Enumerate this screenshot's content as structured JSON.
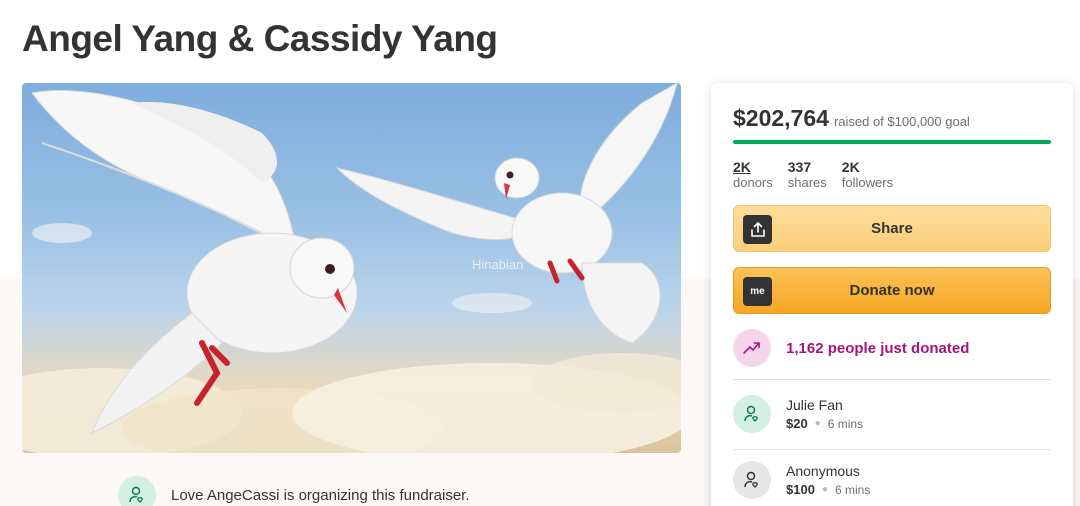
{
  "page": {
    "title": "Angel Yang & Cassidy Yang"
  },
  "hero": {
    "watermark": "Hinabian",
    "image_description_icon": "doves-photo"
  },
  "organizer": {
    "text": "Love AngeCassi is organizing this fundraiser.",
    "icon": "person-heart-icon"
  },
  "donation_card": {
    "amount_raised": "$202,764",
    "goal_text": "raised of $100,000 goal",
    "progress": 1.0,
    "stats": [
      {
        "value": "2K",
        "label": "donors"
      },
      {
        "value": "337",
        "label": "shares"
      },
      {
        "value": "2K",
        "label": "followers"
      }
    ],
    "share_label": "Share",
    "donate_label": "Donate now",
    "donate_icon_text": "me",
    "recent_text": "1,162 people just donated",
    "donors": [
      {
        "name": "Julie Fan",
        "amount": "$20",
        "time": "6 mins",
        "icon": "person-heart-icon"
      },
      {
        "name": "Anonymous",
        "amount": "$100",
        "time": "6 mins",
        "icon": "person-heart-icon"
      }
    ]
  },
  "colors": {
    "progress_green": "#02a95c",
    "share_yellow": "#fbcf7a",
    "donate_orange": "#f5a623",
    "recent_magenta": "#a6147d"
  }
}
